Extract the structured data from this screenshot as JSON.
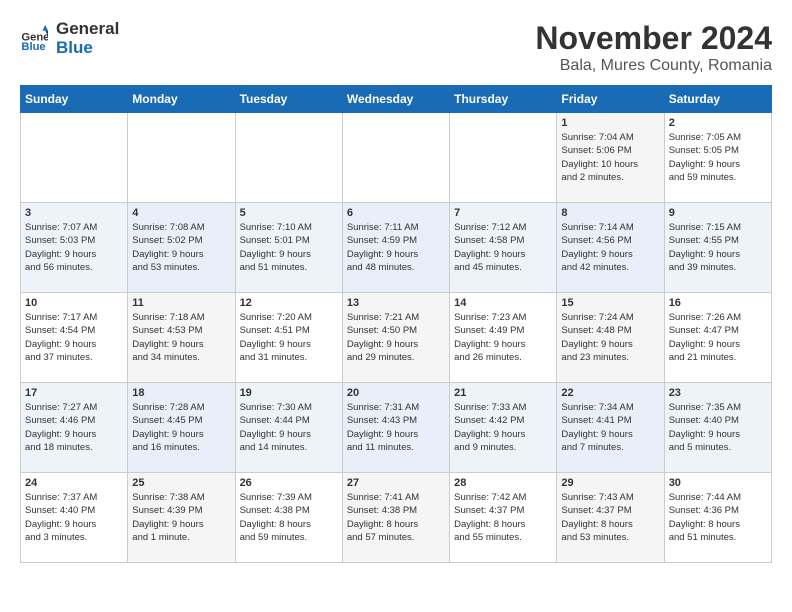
{
  "logo": {
    "line1": "General",
    "line2": "Blue"
  },
  "title": "November 2024",
  "location": "Bala, Mures County, Romania",
  "days_of_week": [
    "Sunday",
    "Monday",
    "Tuesday",
    "Wednesday",
    "Thursday",
    "Friday",
    "Saturday"
  ],
  "weeks": [
    [
      {
        "day": "",
        "info": ""
      },
      {
        "day": "",
        "info": ""
      },
      {
        "day": "",
        "info": ""
      },
      {
        "day": "",
        "info": ""
      },
      {
        "day": "",
        "info": ""
      },
      {
        "day": "1",
        "info": "Sunrise: 7:04 AM\nSunset: 5:06 PM\nDaylight: 10 hours\nand 2 minutes."
      },
      {
        "day": "2",
        "info": "Sunrise: 7:05 AM\nSunset: 5:05 PM\nDaylight: 9 hours\nand 59 minutes."
      }
    ],
    [
      {
        "day": "3",
        "info": "Sunrise: 7:07 AM\nSunset: 5:03 PM\nDaylight: 9 hours\nand 56 minutes."
      },
      {
        "day": "4",
        "info": "Sunrise: 7:08 AM\nSunset: 5:02 PM\nDaylight: 9 hours\nand 53 minutes."
      },
      {
        "day": "5",
        "info": "Sunrise: 7:10 AM\nSunset: 5:01 PM\nDaylight: 9 hours\nand 51 minutes."
      },
      {
        "day": "6",
        "info": "Sunrise: 7:11 AM\nSunset: 4:59 PM\nDaylight: 9 hours\nand 48 minutes."
      },
      {
        "day": "7",
        "info": "Sunrise: 7:12 AM\nSunset: 4:58 PM\nDaylight: 9 hours\nand 45 minutes."
      },
      {
        "day": "8",
        "info": "Sunrise: 7:14 AM\nSunset: 4:56 PM\nDaylight: 9 hours\nand 42 minutes."
      },
      {
        "day": "9",
        "info": "Sunrise: 7:15 AM\nSunset: 4:55 PM\nDaylight: 9 hours\nand 39 minutes."
      }
    ],
    [
      {
        "day": "10",
        "info": "Sunrise: 7:17 AM\nSunset: 4:54 PM\nDaylight: 9 hours\nand 37 minutes."
      },
      {
        "day": "11",
        "info": "Sunrise: 7:18 AM\nSunset: 4:53 PM\nDaylight: 9 hours\nand 34 minutes."
      },
      {
        "day": "12",
        "info": "Sunrise: 7:20 AM\nSunset: 4:51 PM\nDaylight: 9 hours\nand 31 minutes."
      },
      {
        "day": "13",
        "info": "Sunrise: 7:21 AM\nSunset: 4:50 PM\nDaylight: 9 hours\nand 29 minutes."
      },
      {
        "day": "14",
        "info": "Sunrise: 7:23 AM\nSunset: 4:49 PM\nDaylight: 9 hours\nand 26 minutes."
      },
      {
        "day": "15",
        "info": "Sunrise: 7:24 AM\nSunset: 4:48 PM\nDaylight: 9 hours\nand 23 minutes."
      },
      {
        "day": "16",
        "info": "Sunrise: 7:26 AM\nSunset: 4:47 PM\nDaylight: 9 hours\nand 21 minutes."
      }
    ],
    [
      {
        "day": "17",
        "info": "Sunrise: 7:27 AM\nSunset: 4:46 PM\nDaylight: 9 hours\nand 18 minutes."
      },
      {
        "day": "18",
        "info": "Sunrise: 7:28 AM\nSunset: 4:45 PM\nDaylight: 9 hours\nand 16 minutes."
      },
      {
        "day": "19",
        "info": "Sunrise: 7:30 AM\nSunset: 4:44 PM\nDaylight: 9 hours\nand 14 minutes."
      },
      {
        "day": "20",
        "info": "Sunrise: 7:31 AM\nSunset: 4:43 PM\nDaylight: 9 hours\nand 11 minutes."
      },
      {
        "day": "21",
        "info": "Sunrise: 7:33 AM\nSunset: 4:42 PM\nDaylight: 9 hours\nand 9 minutes."
      },
      {
        "day": "22",
        "info": "Sunrise: 7:34 AM\nSunset: 4:41 PM\nDaylight: 9 hours\nand 7 minutes."
      },
      {
        "day": "23",
        "info": "Sunrise: 7:35 AM\nSunset: 4:40 PM\nDaylight: 9 hours\nand 5 minutes."
      }
    ],
    [
      {
        "day": "24",
        "info": "Sunrise: 7:37 AM\nSunset: 4:40 PM\nDaylight: 9 hours\nand 3 minutes."
      },
      {
        "day": "25",
        "info": "Sunrise: 7:38 AM\nSunset: 4:39 PM\nDaylight: 9 hours\nand 1 minute."
      },
      {
        "day": "26",
        "info": "Sunrise: 7:39 AM\nSunset: 4:38 PM\nDaylight: 8 hours\nand 59 minutes."
      },
      {
        "day": "27",
        "info": "Sunrise: 7:41 AM\nSunset: 4:38 PM\nDaylight: 8 hours\nand 57 minutes."
      },
      {
        "day": "28",
        "info": "Sunrise: 7:42 AM\nSunset: 4:37 PM\nDaylight: 8 hours\nand 55 minutes."
      },
      {
        "day": "29",
        "info": "Sunrise: 7:43 AM\nSunset: 4:37 PM\nDaylight: 8 hours\nand 53 minutes."
      },
      {
        "day": "30",
        "info": "Sunrise: 7:44 AM\nSunset: 4:36 PM\nDaylight: 8 hours\nand 51 minutes."
      }
    ]
  ]
}
